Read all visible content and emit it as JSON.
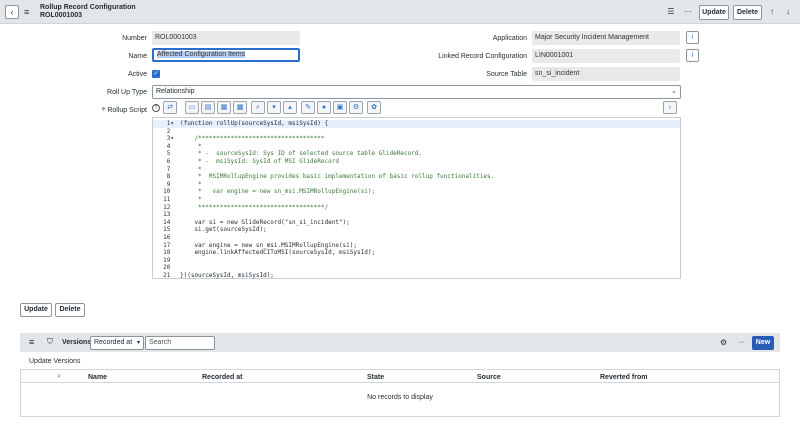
{
  "header": {
    "title": "Rollup Record Configuration",
    "record_number": "ROL0001003",
    "update_label": "Update",
    "delete_label": "Delete",
    "icons": [
      "back-icon",
      "menu-icon",
      "settings-sliders-icon",
      "more-icon",
      "arrow-up-icon",
      "arrow-down-icon"
    ]
  },
  "form": {
    "number": {
      "label": "Number",
      "value": "ROL0001003"
    },
    "name": {
      "label": "Name",
      "value": "Affected Configuration Items"
    },
    "active": {
      "label": "Active",
      "checked": true
    },
    "rollup_type": {
      "label": "Roll Up Type",
      "value": "Relationship"
    },
    "rollup_script": {
      "label": "Rollup Script",
      "required_mark": "✳"
    },
    "application": {
      "label": "Application",
      "value": "Major Security Incident Management"
    },
    "linked_record": {
      "label": "Linked Record Configuration",
      "value": "LIN0001001"
    },
    "source_table": {
      "label": "Source Table",
      "value": "sn_si_incident"
    }
  },
  "script_lines": [
    "(function rollUp(sourceSysId, msiSysId) {",
    "",
    "    /***********************************",
    "     *",
    "     * -  sourceSysId: Sys ID of selected source table GlideRecord.",
    "     * -  msiSysId: SysId of MSI GlideRecord",
    "     *",
    "     *  MSIMRollupEngine provides basic implementation of basic rollup functionalities.",
    "     *",
    "     *   var engine = new sn_msi.MSIMRollupEngine(si);",
    "     *",
    "     ***********************************/",
    "",
    "    var si = new GlideRecord(\"sn_si_incident\");",
    "    si.get(sourceSysId);",
    "",
    "    var engine = new sn_msi.MSIMRollupEngine(si);",
    "    engine.linkAffectedCIToMSI(sourceSysId, msiSysId);",
    "",
    "",
    "})(sourceSysId, msiSysId);"
  ],
  "bottom_buttons": {
    "update": "Update",
    "delete": "Delete"
  },
  "related_list": {
    "title": "Versions",
    "filter_select": "Recorded at",
    "search_placeholder": "Search",
    "new_label": "New",
    "subtitle": "Update Versions",
    "columns": [
      "Name",
      "Recorded at",
      "State",
      "Source",
      "Reverted from"
    ],
    "empty_message": "No records to display"
  }
}
